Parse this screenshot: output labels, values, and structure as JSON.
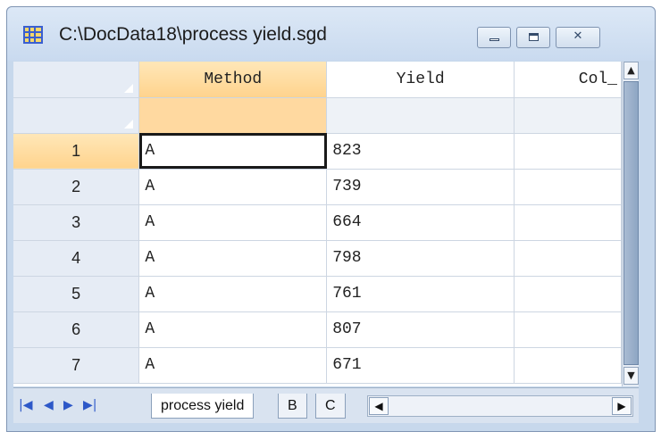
{
  "window": {
    "title": "C:\\DocData18\\process yield.sgd"
  },
  "columns": [
    "Method",
    "Yield",
    "Col_"
  ],
  "rows": [
    {
      "num": "1",
      "method": "A",
      "yield": "823"
    },
    {
      "num": "2",
      "method": "A",
      "yield": "739"
    },
    {
      "num": "3",
      "method": "A",
      "yield": "664"
    },
    {
      "num": "4",
      "method": "A",
      "yield": "798"
    },
    {
      "num": "5",
      "method": "A",
      "yield": "761"
    },
    {
      "num": "6",
      "method": "A",
      "yield": "807"
    },
    {
      "num": "7",
      "method": "A",
      "yield": "671"
    }
  ],
  "tabs": [
    "process yield",
    "B",
    "C"
  ],
  "colors": {
    "selection": "#ffd38d",
    "header_bg": "#e6ecf5"
  }
}
